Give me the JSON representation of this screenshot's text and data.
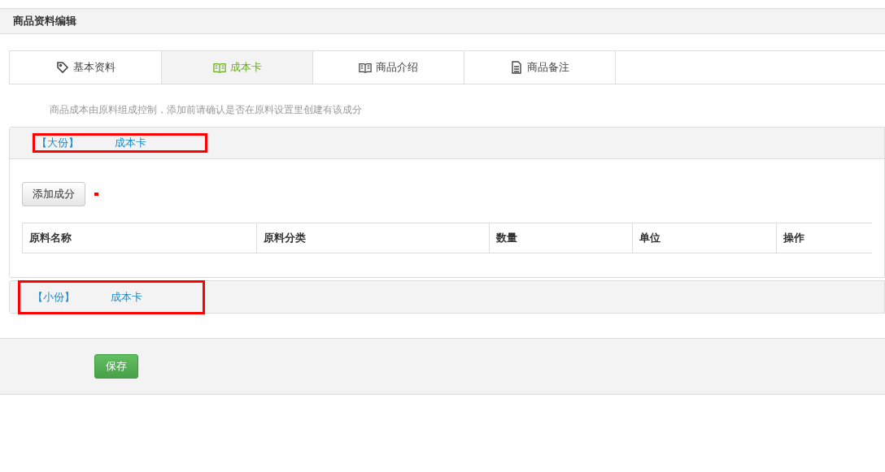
{
  "page_title": "商品资料编辑",
  "tabs": [
    {
      "label": "基本资料",
      "kind": "tag",
      "selected": false
    },
    {
      "label": "成本卡",
      "kind": "book",
      "selected": true
    },
    {
      "label": "商品介绍",
      "kind": "book",
      "selected": false
    },
    {
      "label": "商品备注",
      "kind": "file",
      "selected": false
    }
  ],
  "note": "商品成本由原料组成控制，添加前请确认是否在原料设置里创建有该成分",
  "panels": [
    {
      "size": "【大份】",
      "title": "成本卡",
      "highlighted": true,
      "expanded": true,
      "add_button": "添加成分",
      "columns": [
        "原料名称",
        "原料分类",
        "数量",
        "单位",
        "操作"
      ]
    },
    {
      "size": "【小份】",
      "title": "成本卡",
      "highlighted": true,
      "expanded": false
    }
  ],
  "save_button": "保存"
}
